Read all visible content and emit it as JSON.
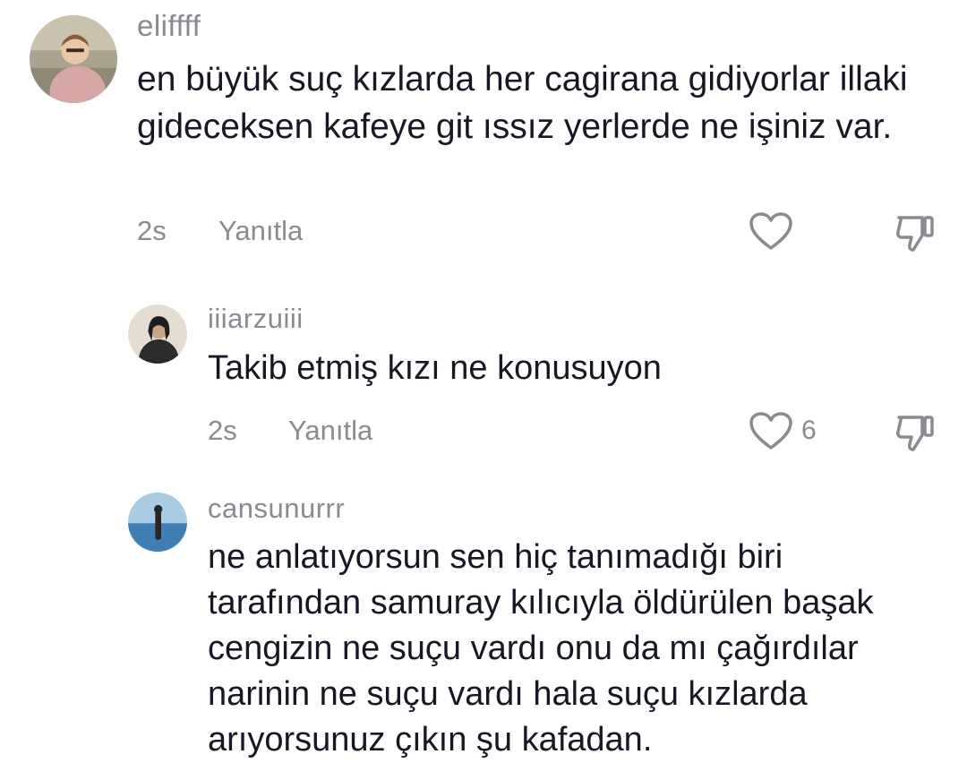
{
  "comments": [
    {
      "username": "eliffff",
      "text": "en büyük suç kızlarda her cagirana gidiyorlar illaki gideceksen kafeye git ıssız yerlerde ne işiniz var.",
      "time": "2s",
      "reply_label": "Yanıtla",
      "like_count": "",
      "avatar_icon": "profile-photo-pink-jacket",
      "like_icon": "heart-outline-icon",
      "dislike_icon": "thumbs-down-icon"
    },
    {
      "username": "iiiarzuiii",
      "text": "Takib etmiş kızı ne konusuyon",
      "time": "2s",
      "reply_label": "Yanıtla",
      "like_count": "6",
      "avatar_icon": "profile-photo-dark-hair",
      "like_icon": "heart-outline-icon",
      "dislike_icon": "thumbs-down-icon"
    },
    {
      "username": "cansunurrr",
      "text": "ne anlatıyorsun sen hiç tanımadığı biri tarafından samuray kılıcıyla öldürülen başak cengizin ne suçu vardı onu da mı çağırdılar narinin ne suçu vardı hala suçu kızlarda arıyorsunuz çıkın şu kafadan.",
      "avatar_icon": "profile-photo-sea"
    }
  ],
  "colors": {
    "text": "#161823",
    "secondary": "#8a8b91",
    "background": "#ffffff"
  }
}
